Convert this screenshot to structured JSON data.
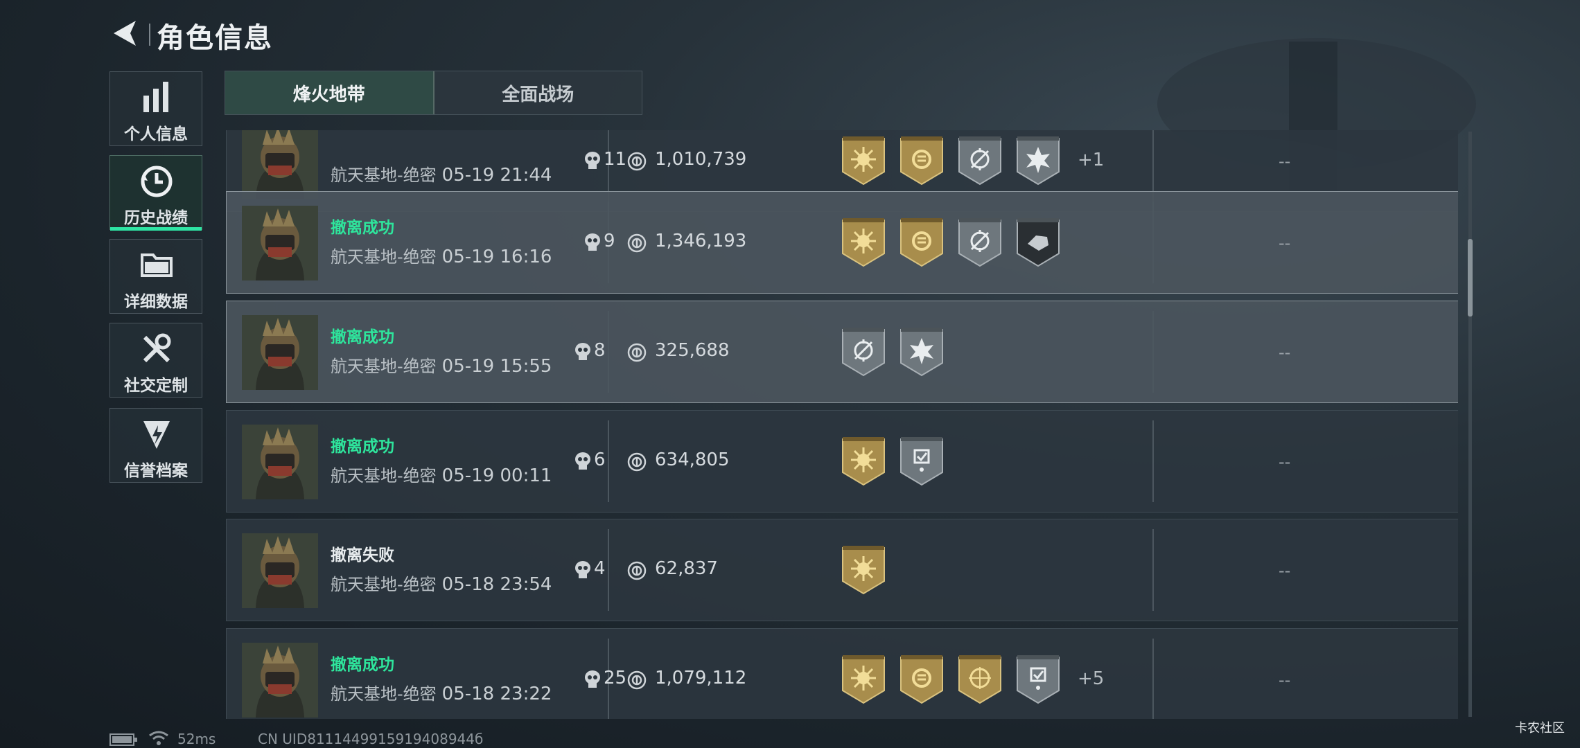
{
  "header": {
    "title": "角色信息"
  },
  "sidebar": {
    "items": [
      {
        "label": "个人信息",
        "icon": "bar-chart-icon"
      },
      {
        "label": "历史战绩",
        "icon": "history-clock-icon"
      },
      {
        "label": "详细数据",
        "icon": "folder-icon"
      },
      {
        "label": "社交定制",
        "icon": "tools-icon"
      },
      {
        "label": "信誉档案",
        "icon": "shield-bolt-icon"
      }
    ]
  },
  "tabs": [
    {
      "label": "烽火地带"
    },
    {
      "label": "全面战场"
    }
  ],
  "rows": [
    {
      "status": "",
      "location": "航天基地-绝密",
      "time": "05-19 21:44",
      "value": "1,010,739",
      "kills": "11",
      "plus": "+1",
      "result": "--"
    },
    {
      "status": "撤离成功",
      "location": "航天基地-绝密",
      "time": "05-19 16:16",
      "value": "1,346,193",
      "kills": "9",
      "plus": "",
      "result": "--"
    },
    {
      "status": "撤离成功",
      "location": "航天基地-绝密",
      "time": "05-19 15:55",
      "value": "325,688",
      "kills": "8",
      "plus": "",
      "result": "--"
    },
    {
      "status": "撤离成功",
      "location": "航天基地-绝密",
      "time": "05-19 00:11",
      "value": "634,805",
      "kills": "6",
      "plus": "",
      "result": "--"
    },
    {
      "status": "撤离失败",
      "location": "航天基地-绝密",
      "time": "05-18 23:54",
      "value": "62,837",
      "kills": "4",
      "plus": "",
      "result": "--"
    },
    {
      "status": "撤离成功",
      "location": "航天基地-绝密",
      "time": "05-18 23:22",
      "value": "1,079,112",
      "kills": "25",
      "plus": "+5",
      "result": "--"
    }
  ],
  "footer": {
    "ping": "52ms",
    "uid": "CN UID8111449915919408944б"
  },
  "watermark": "卡农社区",
  "colors": {
    "accent": "#2ee5a4",
    "success": "#2ee59c",
    "gold_badge": "#b49a55",
    "silver_badge": "#7f878d"
  }
}
